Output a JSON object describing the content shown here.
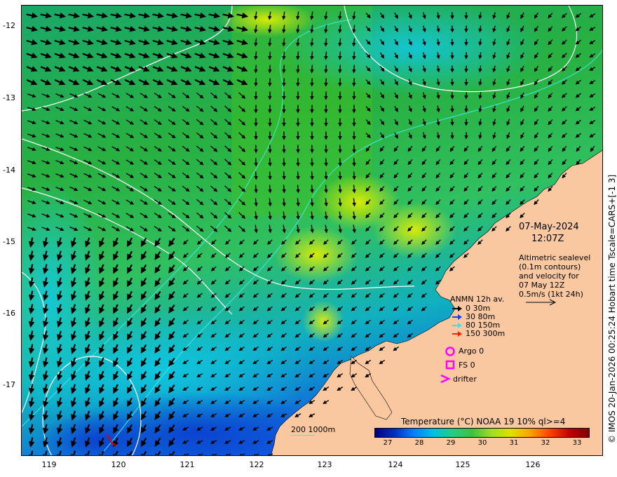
{
  "map": {
    "date": "07-May-2024",
    "time": "12:07Z",
    "altimetry_lines": [
      "Altimetric sealevel",
      "(0.1m contours)",
      "and velocity for",
      "07 May 12Z",
      "0.5m/s (1kt 24h)"
    ],
    "lat_ticks": [
      "-12",
      "-13",
      "-14",
      "-15",
      "-16",
      "-17"
    ],
    "lon_ticks": [
      "119",
      "120",
      "121",
      "122",
      "123",
      "124",
      "125",
      "126"
    ],
    "lat_range": [
      -17.95,
      -11.7
    ],
    "lon_range": [
      118.6,
      126.9
    ]
  },
  "legend": {
    "title": "ANMN 12h av.",
    "depths": [
      {
        "label": "0 30m",
        "color": "#000000"
      },
      {
        "label": "30 80m",
        "color": "#1040ff"
      },
      {
        "label": "80 150m",
        "color": "#40e0f0"
      },
      {
        "label": "150 300m",
        "color": "#ff2000"
      }
    ],
    "argo": "Argo 0",
    "fs": "FS 0",
    "drifter": "drifter",
    "marker_color": "#ff00ff"
  },
  "bathymetry_label": "200  1000m",
  "colorbar": {
    "title": "Temperature (°C) NOAA 19 10% ql>=4",
    "ticks": [
      "27",
      "28",
      "29",
      "30",
      "31",
      "32",
      "33"
    ],
    "colors": [
      "#000080",
      "#0030c0",
      "#0080ff",
      "#00c0e0",
      "#20d080",
      "#40c040",
      "#a0e020",
      "#e0e000",
      "#ffa000",
      "#ff4000",
      "#c00000",
      "#800000"
    ]
  },
  "credit": "© IMOS 20-Jan-2026 00:25:24 Hobart time Tscale=CARS+[-1 3]"
}
